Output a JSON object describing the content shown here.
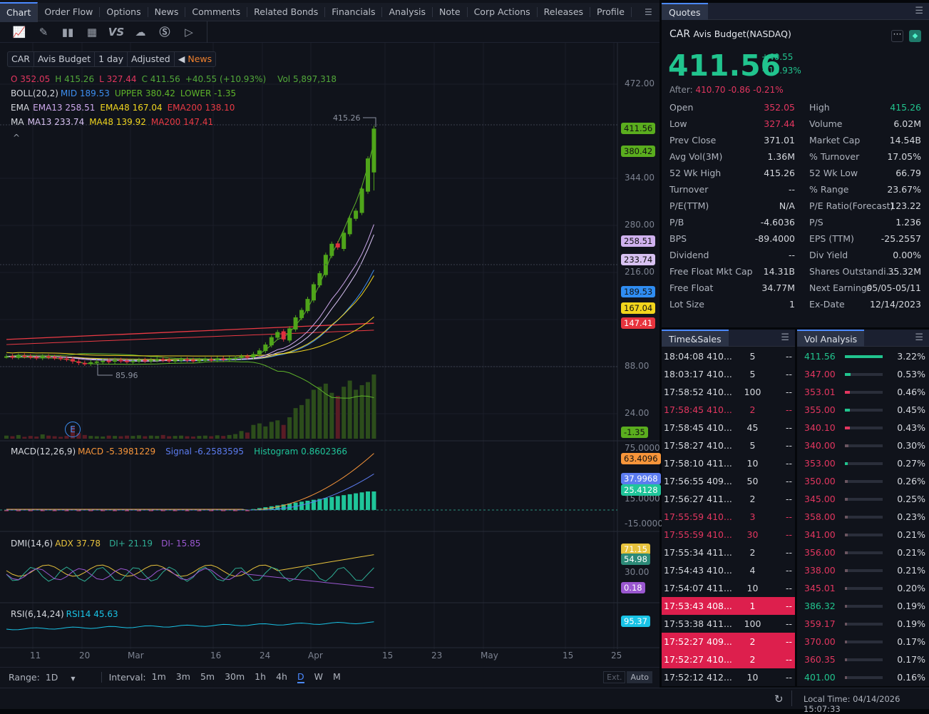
{
  "tabs": [
    "Chart",
    "Order Flow",
    "Options",
    "News",
    "Comments",
    "Related Bonds",
    "Financials",
    "Analysis",
    "Note",
    "Corp Actions",
    "Releases",
    "Profile"
  ],
  "toolbar_icons": [
    "indicator-icon",
    "draw-icon",
    "candle-type-icon",
    "layout-icon",
    "compare-icon",
    "cloud-icon",
    "dollar-icon",
    "play-icon"
  ],
  "toolbar_vs": "VS",
  "symbol_bar": {
    "ticker": "CAR",
    "name": "Avis Budget",
    "period": "1 day",
    "adjust": "Adjusted",
    "news": "News"
  },
  "ohlc": {
    "o": "O  352.05",
    "h": "H  415.26",
    "l": "L  327.44",
    "c": "C  411.56",
    "chg": "+40.55 (+10.93%)",
    "vol": "Vol  5,897,318"
  },
  "boll": {
    "label": "BOLL(20,2)",
    "mid": "MID 189.53",
    "upper": "UPPER 380.42",
    "lower": "LOWER -1.35"
  },
  "ema": {
    "label": "EMA",
    "e13": "EMA13 258.51",
    "e48": "EMA48 167.04",
    "e200": "EMA200 138.10"
  },
  "ma": {
    "label": "MA",
    "m13": "MA13 233.74",
    "m48": "MA48 139.92",
    "m200": "MA200 147.41"
  },
  "high_marker": "415.26",
  "low_marker": "85.96",
  "earnings_marker": "E",
  "price_axis": [
    "472.00",
    "344.00",
    "280.00",
    "216.00",
    "88.00",
    "24.00"
  ],
  "price_labels": [
    {
      "v": "411.56",
      "c": "#5aad1e"
    },
    {
      "v": "380.42",
      "c": "#5aad1e"
    },
    {
      "v": "258.51",
      "c": "#cfb1ee"
    },
    {
      "v": "233.74",
      "c": "#d8c2f2"
    },
    {
      "v": "189.53",
      "c": "#2f8df2"
    },
    {
      "v": "167.04",
      "c": "#f2d51d"
    },
    {
      "v": "147.41",
      "c": "#e8343e"
    },
    {
      "v": "-1.35",
      "c": "#5aad1e"
    }
  ],
  "macd": {
    "label": "MACD(12,26,9)",
    "macd": "MACD -5.3981229",
    "signal": "Signal -6.2583595",
    "hist": "Histogram 0.8602366",
    "axis": [
      "75.0000",
      "15.0000",
      "-15.0000"
    ],
    "labels": [
      {
        "v": "63.4096",
        "c": "#f7953a"
      },
      {
        "v": "37.9968",
        "c": "#5c7cf0"
      },
      {
        "v": "25.4128",
        "c": "#1fc59a"
      }
    ]
  },
  "dmi": {
    "label": "DMI(14,6)",
    "adx": "ADX 37.78",
    "dip": "DI+ 21.19",
    "dim": "DI- 15.85",
    "axis": [
      "30.00"
    ],
    "labels": [
      {
        "v": "71.15",
        "c": "#e7c23c"
      },
      {
        "v": "54.98",
        "c": "#2c8a78"
      },
      {
        "v": "0.18",
        "c": "#9a57d0"
      }
    ]
  },
  "rsi": {
    "label": "RSI(6,14,24)",
    "rsi14": "RSI14 45.63",
    "labels": [
      {
        "v": "95.37",
        "c": "#19c3e6"
      }
    ]
  },
  "date_axis": [
    "11",
    "20",
    "Mar",
    "16",
    "24",
    "Apr",
    "15",
    "23",
    "May",
    "15",
    "25"
  ],
  "range_bar": {
    "range_label": "Range:",
    "range": "1D",
    "interval_label": "Interval:",
    "intervals": [
      "1m",
      "3m",
      "5m",
      "30m",
      "1h",
      "4h",
      "D",
      "W",
      "M"
    ],
    "active_interval": "D",
    "ext": "Ext.",
    "auto": "Auto"
  },
  "chart_data": {
    "type": "candlestick",
    "ylim": [
      24,
      472
    ],
    "closes": [
      102,
      101,
      103,
      102,
      101,
      100,
      102,
      101,
      100,
      99,
      98,
      95,
      93,
      92,
      94,
      95,
      96,
      95,
      97,
      96,
      95,
      96,
      97,
      96,
      97,
      98,
      97,
      96,
      97,
      98,
      97,
      96,
      97,
      98,
      97,
      99,
      98,
      99,
      100,
      102,
      101,
      105,
      110,
      118,
      128,
      135,
      125,
      140,
      155,
      165,
      180,
      200,
      215,
      240,
      255,
      250,
      270,
      290,
      300,
      330,
      371,
      411.56
    ],
    "volumes": [
      10,
      8,
      12,
      6,
      9,
      7,
      14,
      10,
      8,
      6,
      9,
      40,
      18,
      12,
      9,
      8,
      7,
      10,
      9,
      8,
      10,
      9,
      11,
      8,
      10,
      9,
      12,
      8,
      9,
      10,
      8,
      7,
      9,
      10,
      8,
      11,
      9,
      12,
      15,
      25,
      20,
      45,
      50,
      40,
      55,
      60,
      45,
      70,
      100,
      110,
      130,
      160,
      170,
      180,
      150,
      140,
      170,
      190,
      160,
      175,
      185,
      210
    ]
  },
  "quotes": {
    "title": "Quotes",
    "ticker": "CAR",
    "name": "Avis Budget(NASDAQ)",
    "price": "411.56",
    "change": "+40.55",
    "change_pct": "+10.93%",
    "after_label": "After:",
    "after": "410.70 -0.86 -0.21%",
    "rows": [
      [
        "Open",
        "352.05",
        "High",
        "415.26"
      ],
      [
        "Low",
        "327.44",
        "Volume",
        "6.02M"
      ],
      [
        "Prev Close",
        "371.01",
        "Market Cap",
        "14.54B"
      ],
      [
        "Avg Vol(3M)",
        "1.36M",
        "% Turnover",
        "17.05%"
      ],
      [
        "52 Wk High",
        "415.26",
        "52 Wk Low",
        "66.79"
      ],
      [
        "Turnover",
        "--",
        "% Range",
        "23.67%"
      ],
      [
        "P/E(TTM)",
        "N/A",
        "P/E Ratio(Forecast)",
        "123.22"
      ],
      [
        "P/B",
        "-4.6036",
        "P/S",
        "1.236"
      ],
      [
        "BPS",
        "-89.4000",
        "EPS (TTM)",
        "-25.2557"
      ],
      [
        "Dividend",
        "--",
        "Div Yield",
        "0.00%"
      ],
      [
        "Free Float Mkt Cap",
        "14.31B",
        "Shares Outstandi...",
        "35.32M"
      ],
      [
        "Free Float",
        "34.77M",
        "Next Earnings",
        "05/05-05/11"
      ],
      [
        "Lot Size",
        "1",
        "Ex-Date",
        "12/14/2023"
      ]
    ]
  },
  "time_sales": {
    "title": "Time&Sales",
    "rows": [
      {
        "t": "18:04:08 410...",
        "q": "5",
        "d": "--",
        "s": "n"
      },
      {
        "t": "18:03:17 410...",
        "q": "5",
        "d": "--",
        "s": "n"
      },
      {
        "t": "17:58:52 410...",
        "q": "100",
        "d": "--",
        "s": "n"
      },
      {
        "t": "17:58:45 410...",
        "q": "2",
        "d": "--",
        "s": "r"
      },
      {
        "t": "17:58:45 410...",
        "q": "45",
        "d": "--",
        "s": "n"
      },
      {
        "t": "17:58:27 410...",
        "q": "5",
        "d": "--",
        "s": "n"
      },
      {
        "t": "17:58:10 411...",
        "q": "10",
        "d": "--",
        "s": "n"
      },
      {
        "t": "17:56:55 409...",
        "q": "50",
        "d": "--",
        "s": "n"
      },
      {
        "t": "17:56:27 411...",
        "q": "2",
        "d": "--",
        "s": "n"
      },
      {
        "t": "17:55:59 410...",
        "q": "3",
        "d": "--",
        "s": "r"
      },
      {
        "t": "17:55:59 410...",
        "q": "30",
        "d": "--",
        "s": "r"
      },
      {
        "t": "17:55:34 411...",
        "q": "2",
        "d": "--",
        "s": "n"
      },
      {
        "t": "17:54:43 410...",
        "q": "4",
        "d": "--",
        "s": "n"
      },
      {
        "t": "17:54:07 411...",
        "q": "10",
        "d": "--",
        "s": "n"
      },
      {
        "t": "17:53:43 408...",
        "q": "1",
        "d": "--",
        "s": "h"
      },
      {
        "t": "17:53:38 411...",
        "q": "100",
        "d": "--",
        "s": "n"
      },
      {
        "t": "17:52:27 409...",
        "q": "2",
        "d": "--",
        "s": "h"
      },
      {
        "t": "17:52:27 410...",
        "q": "2",
        "d": "--",
        "s": "h"
      },
      {
        "t": "17:52:12 412...",
        "q": "10",
        "d": "--",
        "s": "n"
      }
    ]
  },
  "vol_analysis": {
    "title": "Vol Analysis",
    "rows": [
      {
        "p": "411.56",
        "pct": "3.22%",
        "f": 1,
        "c": "g"
      },
      {
        "p": "347.00",
        "pct": "0.53%",
        "f": 0.16,
        "c": "r",
        "b": "g"
      },
      {
        "p": "353.01",
        "pct": "0.46%",
        "f": 0.14,
        "c": "r",
        "b": "r"
      },
      {
        "p": "355.00",
        "pct": "0.45%",
        "f": 0.14,
        "c": "r",
        "b": "g"
      },
      {
        "p": "340.10",
        "pct": "0.43%",
        "f": 0.13,
        "c": "r",
        "b": "r"
      },
      {
        "p": "340.00",
        "pct": "0.30%",
        "f": 0.09,
        "c": "r",
        "b": "x"
      },
      {
        "p": "353.00",
        "pct": "0.27%",
        "f": 0.08,
        "c": "r",
        "b": "g"
      },
      {
        "p": "350.00",
        "pct": "0.26%",
        "f": 0.08,
        "c": "r",
        "b": "x"
      },
      {
        "p": "345.00",
        "pct": "0.25%",
        "f": 0.08,
        "c": "r",
        "b": "x"
      },
      {
        "p": "358.00",
        "pct": "0.23%",
        "f": 0.07,
        "c": "r",
        "b": "x"
      },
      {
        "p": "341.00",
        "pct": "0.21%",
        "f": 0.07,
        "c": "r",
        "b": "x"
      },
      {
        "p": "356.00",
        "pct": "0.21%",
        "f": 0.07,
        "c": "r",
        "b": "x"
      },
      {
        "p": "338.00",
        "pct": "0.21%",
        "f": 0.07,
        "c": "r",
        "b": "x"
      },
      {
        "p": "345.01",
        "pct": "0.20%",
        "f": 0.06,
        "c": "r",
        "b": "x"
      },
      {
        "p": "386.32",
        "pct": "0.19%",
        "f": 0.06,
        "c": "g",
        "b": "x"
      },
      {
        "p": "359.17",
        "pct": "0.19%",
        "f": 0.06,
        "c": "r",
        "b": "x"
      },
      {
        "p": "370.00",
        "pct": "0.17%",
        "f": 0.05,
        "c": "r",
        "b": "x"
      },
      {
        "p": "360.35",
        "pct": "0.17%",
        "f": 0.05,
        "c": "r",
        "b": "x"
      },
      {
        "p": "401.00",
        "pct": "0.16%",
        "f": 0.05,
        "c": "g",
        "b": "x"
      }
    ]
  },
  "status": {
    "local_time": "Local Time: 04/14/2026 15:07:33"
  }
}
